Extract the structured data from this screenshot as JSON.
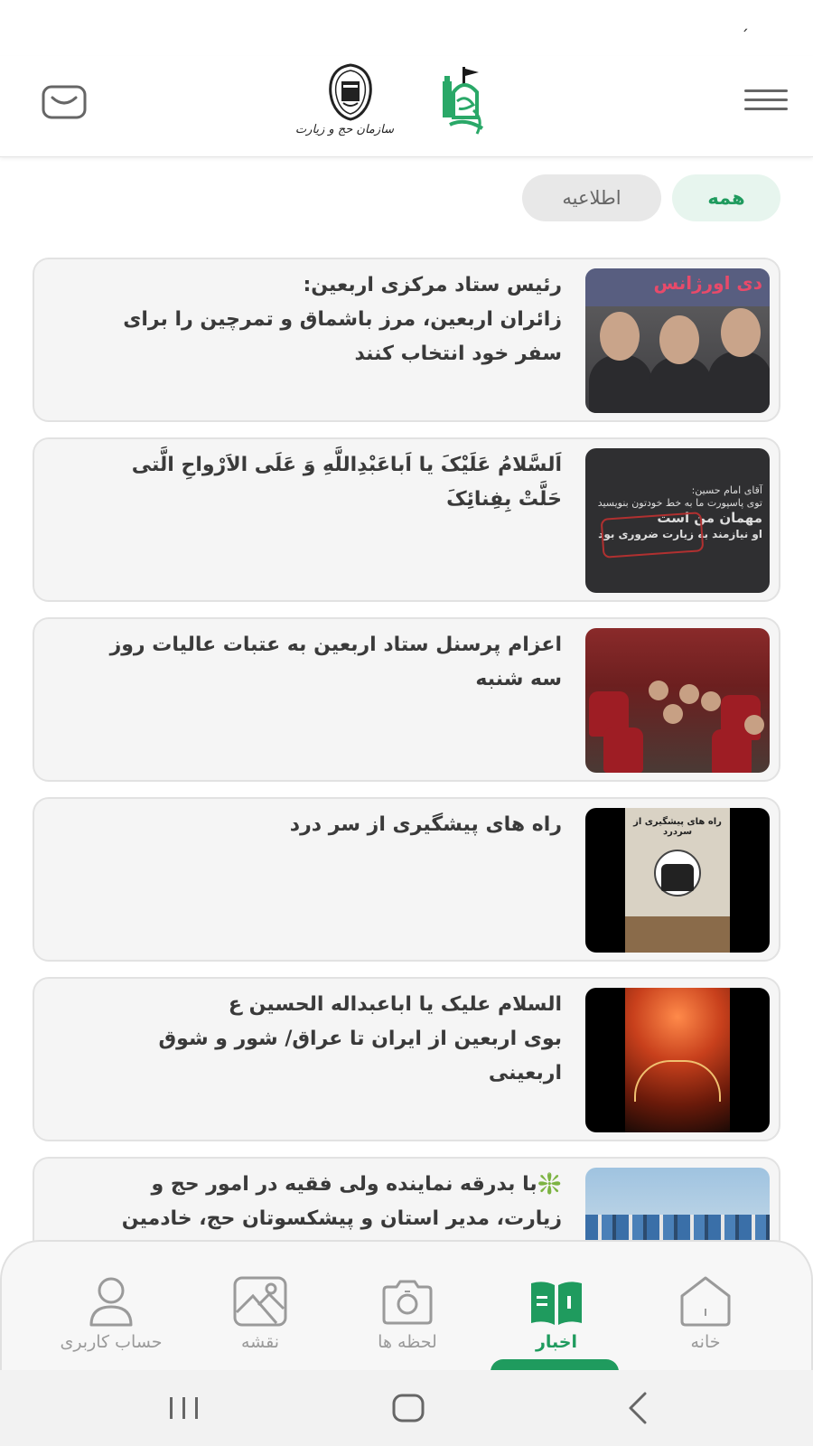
{
  "status_bar": {
    "glyph": "ˊ"
  },
  "header": {
    "logo_hajj_caption": "سازمان حج و زیارت"
  },
  "filters": {
    "all_label": "همه",
    "notice_label": "اطلاعیه",
    "selected": "همه"
  },
  "news": [
    {
      "title": "رئیس ستاد مرکزی اربعین:\nزائران اربعین، مرز باشماق و تمرچین را برای\nسفر خود انتخاب کنند",
      "thumb_banner": "دی اورژانس"
    },
    {
      "title": "اَلسَّلامُ عَلَیْکَ یا اَباعَبْدِاللَّهِ وَ عَلَی الاَرْواحِ الَّتی\nحَلَّتْ بِفِنائِکَ",
      "thumb_line1": "آقای امام حسین:",
      "thumb_line2": "توی پاسپورت ما به خط خودتون بنویسید",
      "thumb_line3": "مهمان من است",
      "thumb_line4": "او نیازمند به زیارت ضروری بود"
    },
    {
      "title": "اعزام پرسنل ستاد اربعین به عتبات عالیات روز\nسه شنبه"
    },
    {
      "title": "راه های پیشگیری از سر درد",
      "thumb_title": "راه های پیشگیری از سردرد"
    },
    {
      "title": "السلام علیک یا اباعبداله الحسین ع\nبوی اربعین از ایران تا عراق/ شور و شوق\nاربعینی"
    },
    {
      "title": "❇️با بدرقه نماینده ولی فقیه در امور حج و\nزیارت، مدیر استان و پیشکسوتان حج، خادمین"
    }
  ],
  "bottom_nav": {
    "items": [
      {
        "label": "خانه",
        "icon": "home-icon"
      },
      {
        "label": "اخبار",
        "icon": "news-icon"
      },
      {
        "label": "لحظه ها",
        "icon": "camera-icon"
      },
      {
        "label": "نقشه",
        "icon": "map-icon"
      },
      {
        "label": "حساب کاربری",
        "icon": "user-icon"
      }
    ],
    "active": "اخبار"
  },
  "colors": {
    "accent": "#1f9b5e",
    "accent_soft": "#e7f5ee",
    "card_bg": "#f5f5f5",
    "inactive": "#9a9a9a"
  }
}
